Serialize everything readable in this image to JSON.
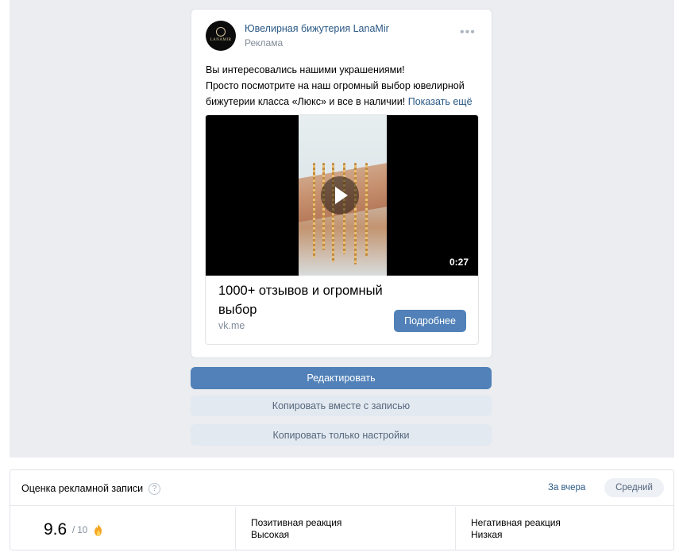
{
  "post": {
    "author": "Ювелирная бижутерия LanaMir",
    "ad_label": "Реклама",
    "avatar_text": "LANAMIR",
    "text_lines": [
      "Вы интересовались нашими украшениями!",
      "Просто посмотрите на наш огромный выбор ювелирной",
      "бижутерии класса «Люкс» и все в наличии!"
    ],
    "show_more": "Показать ещё",
    "video_duration": "0:27",
    "media_title": "1000+ отзывов и огромный выбор",
    "media_link": "vk.me",
    "more_button": "Подробнее"
  },
  "actions": {
    "edit": "Редактировать",
    "copy_with_post": "Копировать вместе с записью",
    "copy_settings": "Копировать только настройки"
  },
  "rating": {
    "title": "Оценка рекламной записи",
    "help": "?",
    "period": "За вчера",
    "level": "Средний",
    "score": "9.6",
    "score_max": "/ 10",
    "positive_label": "Позитивная реакция",
    "positive_value": "Высокая",
    "negative_label": "Негативная реакция",
    "negative_value": "Низкая"
  },
  "colors": {
    "accent": "#5181b8",
    "link": "#2a5885",
    "secondary_button_bg": "#e3e9f0",
    "page_bg": "#ebedf0"
  },
  "icons": [
    "more-horizontal-icon",
    "play-icon",
    "help-icon",
    "fire-icon"
  ]
}
